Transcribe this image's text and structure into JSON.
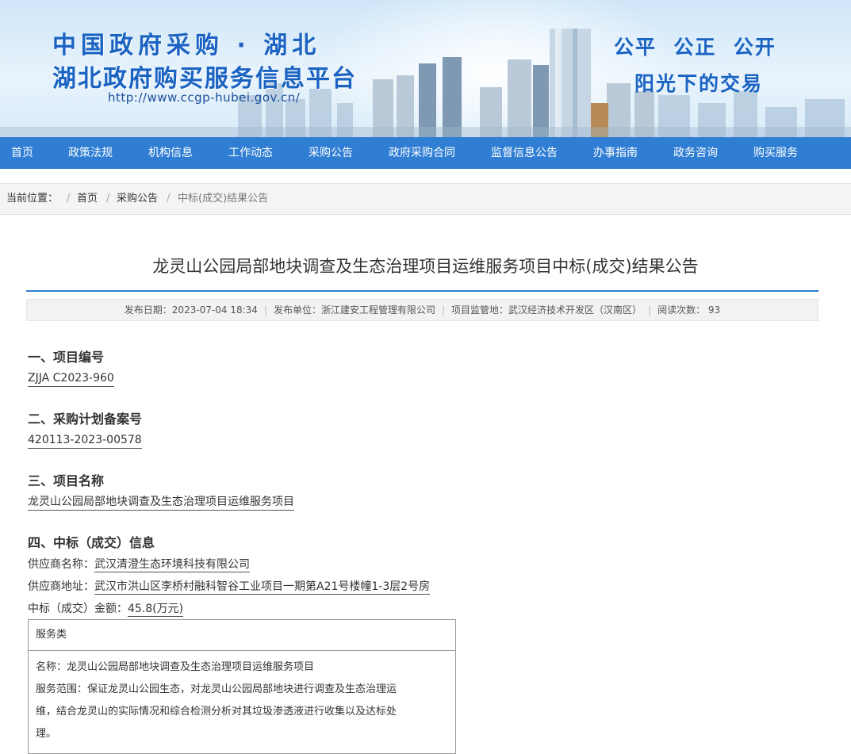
{
  "banner": {
    "title_line1": "中国政府采购 · 湖北",
    "title_line2": "湖北政府购买服务信息平台",
    "url": "http://www.ccgp-hubei.gov.cn/",
    "slogan_line1": "公平  公正  公开",
    "slogan_line2": "阳光下的交易"
  },
  "nav": {
    "items": [
      "首页",
      "政策法规",
      "机构信息",
      "工作动态",
      "采购公告",
      "政府采购合同",
      "监督信息公告",
      "办事指南",
      "政务咨询",
      "购买服务"
    ]
  },
  "breadcrumb": {
    "label": "当前位置：",
    "items": [
      "首页",
      "采购公告",
      "中标(成交)结果公告"
    ]
  },
  "article": {
    "title": "龙灵山公园局部地块调查及生态治理项目运维服务项目中标(成交)结果公告",
    "meta": {
      "publish_date": "发布日期：2023-07-04 18:34",
      "publisher": "发布单位：浙江建安工程管理有限公司",
      "supervision": "项目监管地：武汉经济技术开发区（汉南区）",
      "views": "阅读次数：  93"
    },
    "sections": {
      "s1_heading": "一、项目编号",
      "s1_value": "ZJJA C2023-960",
      "s2_heading": "二、采购计划备案号",
      "s2_value": "420113-2023-00578",
      "s3_heading": "三、项目名称",
      "s3_value": "龙灵山公园局部地块调查及生态治理项目运维服务项目",
      "s4_heading": "四、中标（成交）信息",
      "supplier_name_label": "供应商名称：",
      "supplier_name": "武汉清澄生态环境科技有限公司",
      "supplier_addr_label": "供应商地址：",
      "supplier_addr": "武汉市洪山区李桥村融科智谷工业项目一期第A21号楼幢1-3层2号房",
      "amount_label": "中标（成交）金额：",
      "amount": "45.8(万元)"
    },
    "table": {
      "header": "服务类",
      "name": "名称：龙灵山公园局部地块调查及生态治理项目运维服务项目",
      "scope_l1": "服务范围：保证龙灵山公园生态，对龙灵山公园局部地块进行调查及生态治理运",
      "scope_l2": "维，结合龙灵山的实际情况和综合检测分析对其垃圾渗透液进行收集以及达标处",
      "scope_l3": "理。"
    }
  }
}
